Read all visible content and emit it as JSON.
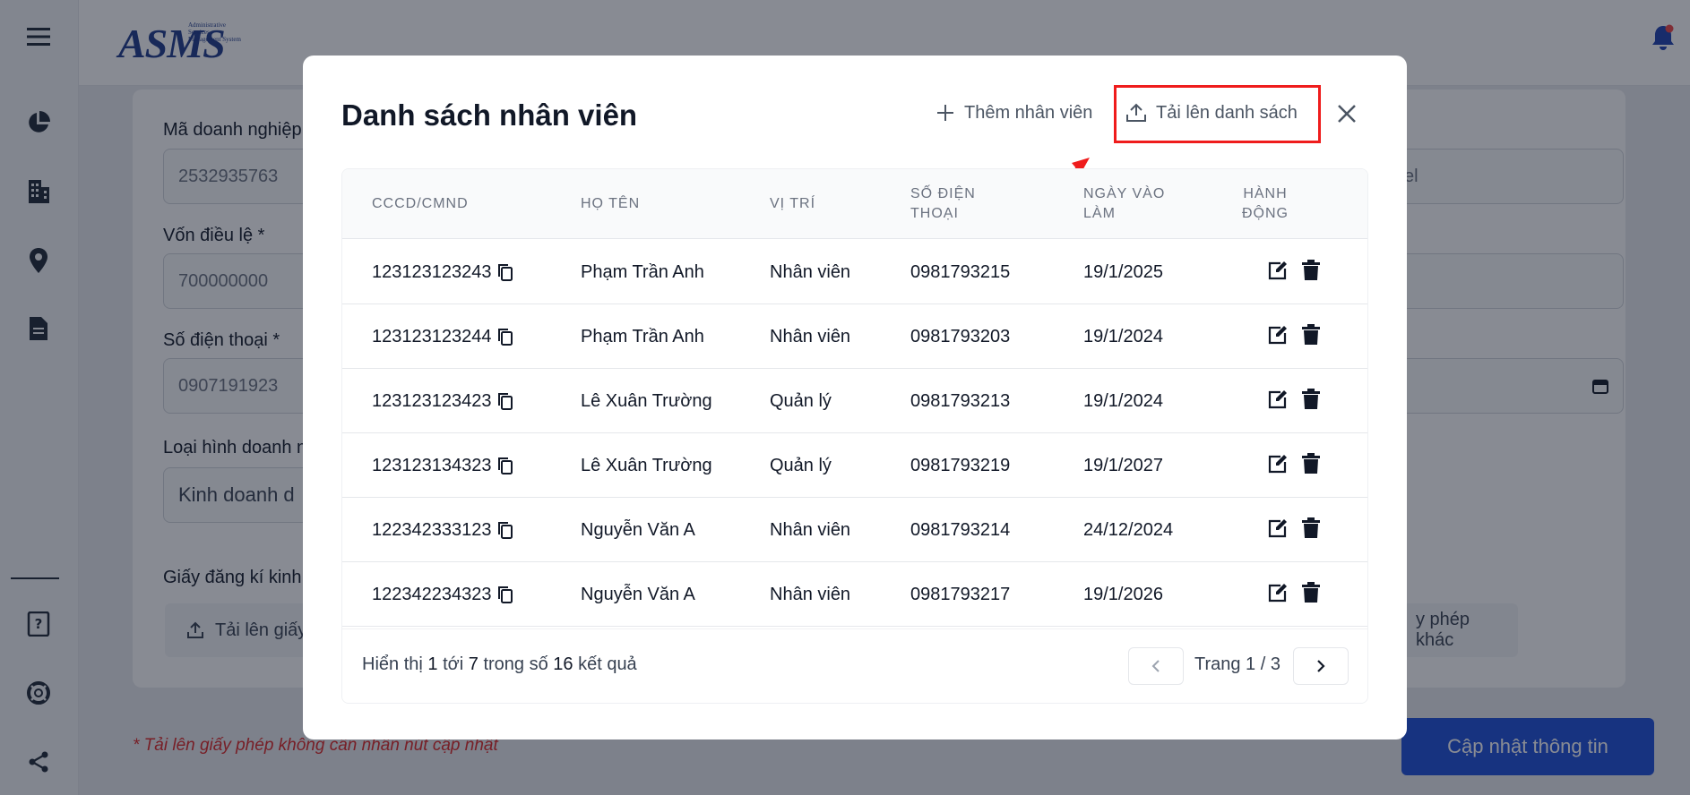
{
  "app": {
    "logo_text": "ASMS",
    "logo_tagline": "Administrative Services Management System"
  },
  "form": {
    "label_tax_code": "Mã doanh nghiệp",
    "value_tax_code": "2532935763",
    "label_capital": "Vốn điều lệ *",
    "value_capital": "700000000",
    "label_phone": "Số điện thoại *",
    "value_phone": "0907191923",
    "label_business_type": "Loại hình doanh n",
    "value_business_type": "Kinh doanh d",
    "label_license": "Giấy đăng kí kinh",
    "upload_license_label": "Tải lên giấy",
    "right_field_partial": "el",
    "other_license_partial": "y phép khác",
    "note": "* Tải lên giấy phép không cần nhấn nút cập nhật",
    "update_button": "Cập nhật thông tin"
  },
  "modal": {
    "title": "Danh sách nhân viên",
    "add_employee": "Thêm nhân viên",
    "upload_list": "Tải lên danh sách",
    "columns": {
      "id": "CCCD/CMND",
      "name": "HỌ TÊN",
      "position": "VỊ TRÍ",
      "phone_l1": "SỐ ĐIỆN",
      "phone_l2": "THOẠI",
      "date_l1": "NGÀY VÀO",
      "date_l2": "LÀM",
      "action_l1": "HÀNH",
      "action_l2": "ĐỘNG"
    },
    "rows": [
      {
        "id": "123123123243",
        "name": "Phạm Trần Anh",
        "position": "Nhân viên",
        "phone": "0981793215",
        "date": "19/1/2025"
      },
      {
        "id": "123123123244",
        "name": "Phạm Trần Anh",
        "position": "Nhân viên",
        "phone": "0981793203",
        "date": "19/1/2024"
      },
      {
        "id": "123123123423",
        "name": "Lê Xuân Trường",
        "position": "Quản lý",
        "phone": "0981793213",
        "date": "19/1/2024"
      },
      {
        "id": "123123134323",
        "name": "Lê Xuân Trường",
        "position": "Quản lý",
        "phone": "0981793219",
        "date": "19/1/2027"
      },
      {
        "id": "122342333123",
        "name": "Nguyễn Văn A",
        "position": "Nhân viên",
        "phone": "0981793214",
        "date": "24/12/2024"
      },
      {
        "id": "122342234323",
        "name": "Nguyễn Văn A",
        "position": "Nhân viên",
        "phone": "0981793217",
        "date": "19/1/2026"
      }
    ],
    "pagination": {
      "summary_prefix": "Hiển thị",
      "from": "1",
      "to_word": "tới",
      "to": "7",
      "of_word": "trong số",
      "total": "16",
      "suffix": "kết quả",
      "page_label": "Trang 1 / 3"
    }
  },
  "colors": {
    "accent": "#1d4ed8",
    "highlight": "#ef1c1c",
    "notification_dot": "#ef4444"
  }
}
